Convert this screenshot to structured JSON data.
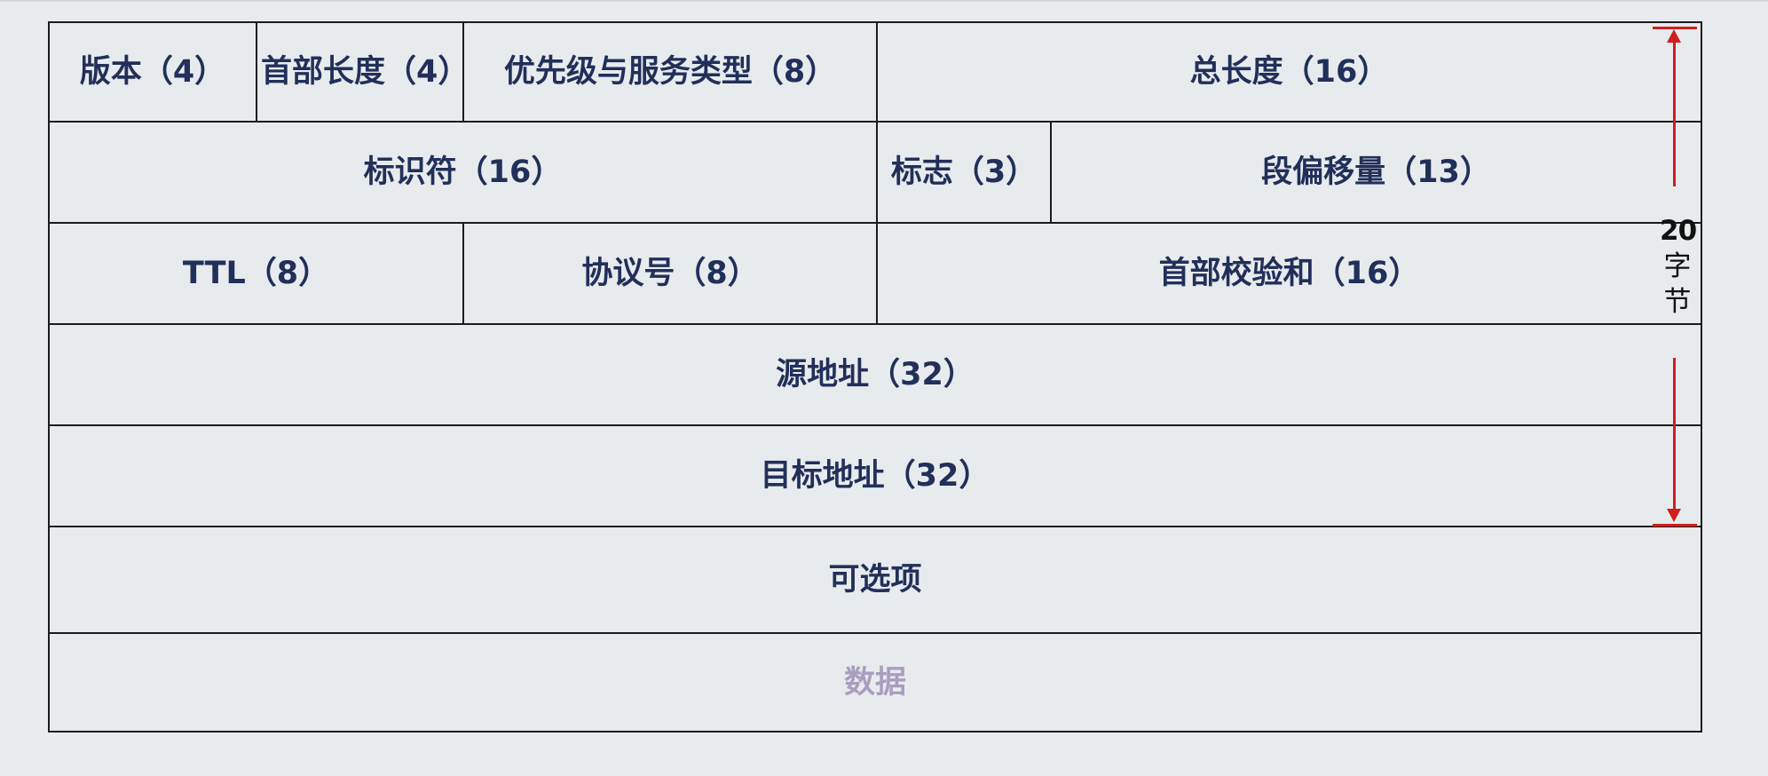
{
  "header": {
    "row1": {
      "version": "版本（4）",
      "header_length": "首部长度（4）",
      "tos": "优先级与服务类型（8）",
      "total_length": "总长度（16）"
    },
    "row2": {
      "identifier": "标识符（16）",
      "flags": "标志（3）",
      "fragment_offset": "段偏移量（13）"
    },
    "row3": {
      "ttl": "TTL（8）",
      "protocol": "协议号（8）",
      "checksum": "首部校验和（16）"
    },
    "source_address": "源地址（32）",
    "destination_address": "目标地址（32）",
    "options": "可选项",
    "data": "数据"
  },
  "size_annotation": {
    "number": "20",
    "char1": "字",
    "char2": "节"
  },
  "colors": {
    "field_text": "#21305a",
    "data_text": "#a99dc0",
    "bracket": "#d11e1e",
    "border": "#1c1c1c",
    "background": "#e9ecee"
  }
}
